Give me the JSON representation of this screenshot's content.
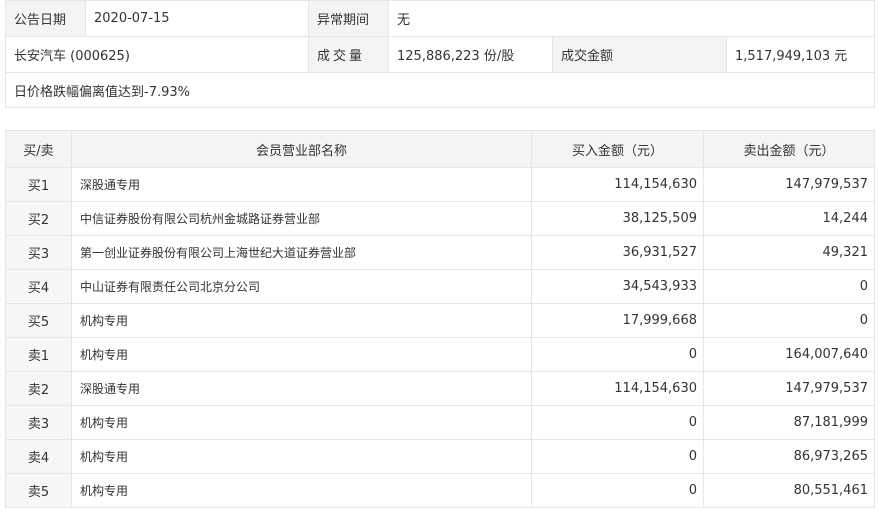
{
  "info": {
    "announce_date_label": "公告日期",
    "announce_date": "2020-07-15",
    "abnormal_period_label": "异常期间",
    "abnormal_period": "无",
    "stock_name": "长安汽车 (000625)",
    "volume_label": "成交量",
    "volume": "125,886,223 份/股",
    "turnover_label": "成交金额",
    "turnover": "1,517,949,103 元",
    "deviation_note": "日价格跌幅偏离值达到-7.93%"
  },
  "trades": {
    "headers": [
      "买/卖",
      "会员营业部名称",
      "买入金额（元）",
      "卖出金额（元）"
    ],
    "rows": [
      {
        "side": "买1",
        "name": "深股通专用",
        "buy": "114,154,630",
        "sell": "147,979,537"
      },
      {
        "side": "买2",
        "name": "中信证券股份有限公司杭州金城路证券营业部",
        "buy": "38,125,509",
        "sell": "14,244"
      },
      {
        "side": "买3",
        "name": "第一创业证券股份有限公司上海世纪大道证券营业部",
        "buy": "36,931,527",
        "sell": "49,321"
      },
      {
        "side": "买4",
        "name": "中山证券有限责任公司北京分公司",
        "buy": "34,543,933",
        "sell": "0"
      },
      {
        "side": "买5",
        "name": "机构专用",
        "buy": "17,999,668",
        "sell": "0"
      },
      {
        "side": "卖1",
        "name": "机构专用",
        "buy": "0",
        "sell": "164,007,640"
      },
      {
        "side": "卖2",
        "name": "深股通专用",
        "buy": "114,154,630",
        "sell": "147,979,537"
      },
      {
        "side": "卖3",
        "name": "机构专用",
        "buy": "0",
        "sell": "87,181,999"
      },
      {
        "side": "卖4",
        "name": "机构专用",
        "buy": "0",
        "sell": "86,973,265"
      },
      {
        "side": "卖5",
        "name": "机构专用",
        "buy": "0",
        "sell": "80,551,461"
      }
    ]
  }
}
